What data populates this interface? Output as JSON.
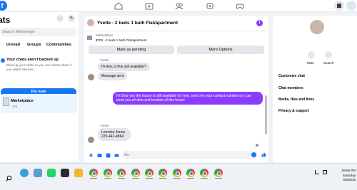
{
  "topbar": {
    "logo": "f",
    "nav_icons": [
      "home-icon",
      "watch-icon",
      "marketplace-icon",
      "groups-icon",
      "gaming-icon"
    ],
    "right_icons": [
      "apps-grid-icon",
      "messenger-icon"
    ]
  },
  "sidebar": {
    "title": "Chats",
    "title_visible": "ats",
    "more_label": "···",
    "compose_label": "✎",
    "search_placeholder": "Search Messenger",
    "tabs": [
      "Unread",
      "Groups",
      "Communities"
    ],
    "backup": {
      "title": "Your chats aren't backed up",
      "text": "Back up your chats so you can restore them if you switch devices."
    },
    "fix_button": "Fix now",
    "chat": {
      "name": "Marketplace",
      "meta": "· 3m"
    }
  },
  "conversation": {
    "title": "Yvette - 2 beds 1 bath Flat/apartment",
    "info_icon": "i",
    "marketplace_card": {
      "label": "Marketplace",
      "title": "$700 - 2 beds 1 bath Flat/apartment",
      "pending_button": "Mark as pending",
      "more_button": "More Options"
    },
    "messages": [
      {
        "sender": "Yvette",
        "text": "Hi Roy, is this still available?",
        "mine": false
      },
      {
        "text": "Message sent",
        "mine": false
      },
      {
        "text": "Hi Dear yes the house is still available for rent, send me your contact number so i can send you all deta and location of this house",
        "mine": true
      },
      {
        "sender": "Yvette",
        "text": "Lorraine Jones 225-442-4864",
        "mine": false
      }
    ],
    "composer_placeholder": "Aa"
  },
  "info_panel": {
    "mute_label": "Mute",
    "search_label": "Search",
    "items": [
      "Customize chat",
      "Chat members",
      "Media, files and links",
      "Privacy & support"
    ]
  },
  "taskbar": {
    "time": "09:56 PM",
    "day": "Saturday",
    "date": "6/6/2026"
  },
  "colors": {
    "brand_blue": "#1877f2",
    "sent_bubble": "#8b3dff",
    "background": "#f0f2f5"
  }
}
